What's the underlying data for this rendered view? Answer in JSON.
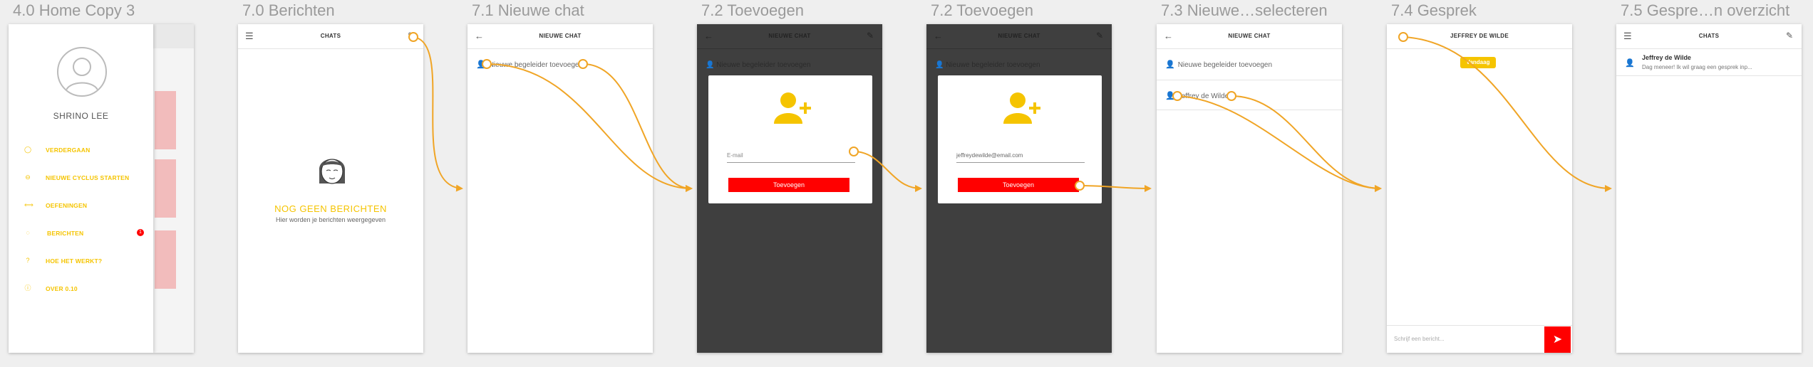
{
  "colors": {
    "accent": "#f5c400",
    "red": "#ff0000",
    "flow": "#f0a526",
    "dark_bg": "#3f3f3f",
    "canvas": "#efefef"
  },
  "artboards": [
    {
      "label": "4.0 Home Copy 3"
    },
    {
      "label": "7.0 Berichten"
    },
    {
      "label": "7.1 Nieuwe chat"
    },
    {
      "label": "7.2 Toevoegen"
    },
    {
      "label": "7.2 Toevoegen"
    },
    {
      "label": "7.3 Nieuwe…selecteren"
    },
    {
      "label": "7.4 Gesprek"
    },
    {
      "label": "7.5 Gespre…n overzicht"
    }
  ],
  "home": {
    "user_name": "SHRINO LEE",
    "menu": [
      {
        "label": "VERDERGAAN",
        "icon": "circle-icon"
      },
      {
        "label": "NIEUWE CYCLUS STARTEN",
        "icon": "plus-circle-icon"
      },
      {
        "label": "OEFENINGEN",
        "icon": "dumbbell-icon"
      },
      {
        "label": "BERICHTEN",
        "icon": "chat-icon",
        "badge": "1"
      },
      {
        "label": "HOE HET WERKT?",
        "icon": "question-icon"
      },
      {
        "label": "OVER 0.10",
        "icon": "info-icon"
      }
    ]
  },
  "berichten": {
    "title": "CHATS",
    "empty_title": "NOG GEEN BERICHTEN",
    "empty_sub": "Hier worden je berichten weergegeven"
  },
  "nieuwe_chat": {
    "title": "NIEUWE CHAT",
    "add_row": "Nieuwe begeleider toevoegen"
  },
  "toevoegen1": {
    "title": "NIEUWE CHAT",
    "add_row": "Nieuwe begeleider toevoegen",
    "email_placeholder": "E-mail",
    "button": "Toevoegen"
  },
  "toevoegen2": {
    "title": "NIEUWE CHAT",
    "add_row": "Nieuwe begeleider toevoegen",
    "email_value": "jeffreydewilde@email.com",
    "button": "Toevoegen"
  },
  "selecteren": {
    "title": "NIEUWE CHAT",
    "add_row": "Nieuwe begeleider toevoegen",
    "contact": "Jeffrey de Wilde"
  },
  "gesprek": {
    "title": "JEFFREY DE WILDE",
    "date_badge": "Vandaag",
    "input_placeholder": "Schrijf een bericht..."
  },
  "overzicht": {
    "title": "CHATS",
    "chat_name": "Jeffrey de Wilde",
    "chat_preview": "Dag meneer! Ik wil graag een gesprek inp..."
  }
}
